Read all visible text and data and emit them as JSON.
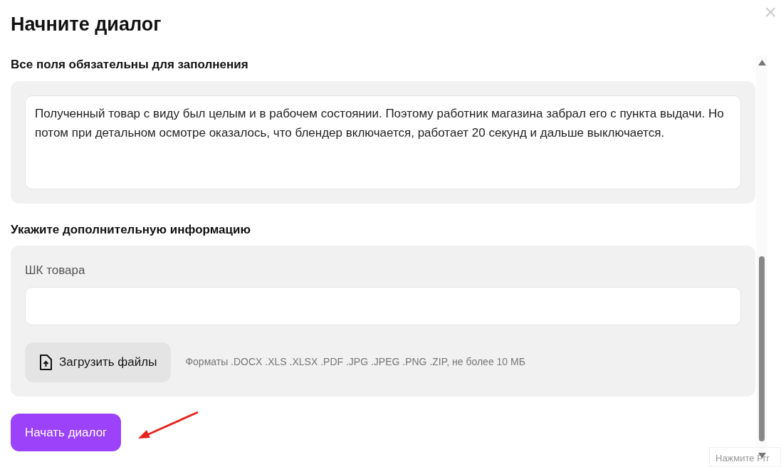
{
  "dialog": {
    "title": "Начните диалог",
    "close": "×"
  },
  "description": {
    "label": "Все поля обязательны для заполнения",
    "value": "Полученный товар с виду был целым и в рабочем состоянии. Поэтому работник магазина забрал его с пункта выдачи. Но потом при детальном осмотре оказалось, что блендер включается, работает 20 секунд и дальше выключается."
  },
  "extra": {
    "label": "Укажите дополнительную информацию",
    "barcode_label": "ШК товара",
    "upload_button": "Загрузить файлы",
    "formats": "Форматы .DOCX .XLS .XLSX .PDF .JPG .JPEG .PNG .ZIP, не более 10 МБ"
  },
  "submit": "Начать диалог",
  "tooltip": "Нажмите Prr"
}
